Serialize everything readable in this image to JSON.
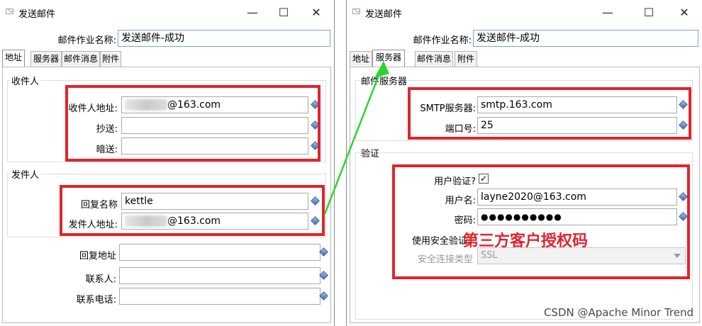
{
  "left": {
    "title": "发送邮件",
    "controls": {
      "minimize": "—",
      "maximize": "☐",
      "close": "✕"
    },
    "job_name_label": "邮件作业名称:",
    "job_name_value": "发送邮件-成功",
    "tabs": [
      "地址",
      "服务器",
      "邮件消息",
      "附件"
    ],
    "active_tab": "地址",
    "recipient_group": "收件人",
    "recipient_address_label": "收件人地址:",
    "recipient_address_suffix": "@163.com",
    "cc_label": "抄送:",
    "bcc_label": "暗送:",
    "sender_group": "发件人",
    "reply_name_label": "回复名称",
    "reply_name_value": "kettle",
    "sender_address_label": "发件人地址:",
    "sender_address_suffix": "@163.com",
    "reply_address_label": "回复地址",
    "contact_label": "联系人:",
    "contact_phone_label": "联系电话:"
  },
  "right": {
    "title": "发送邮件",
    "controls": {
      "minimize": "—",
      "maximize": "☐",
      "close": "✕"
    },
    "job_name_label": "邮件作业名称:",
    "job_name_value": "发送邮件-成功",
    "tabs": [
      "地址",
      "服务器",
      "邮件消息",
      "附件"
    ],
    "active_tab": "服务器",
    "mail_server_group": "邮件服务器",
    "smtp_label": "SMTP服务器:",
    "smtp_value": "smtp.163.com",
    "port_label": "端口号:",
    "port_value": "25",
    "auth_group": "验证",
    "use_auth_label": "用户验证?",
    "use_auth_checked": "✓",
    "username_label": "用户名:",
    "username_value": "layne2020@163.com",
    "password_label": "密码:",
    "password_value": "●●●●●●●●●●",
    "secure_auth_label": "使用安全验证",
    "secure_type_label": "安全连接类型",
    "secure_type_value": "SSL",
    "annotation": "第三方客户授权码"
  },
  "watermark": "CSDN @Apache Minor Trend",
  "colors": {
    "highlight_red": "#e0242c",
    "arrow_green": "#2bd62b",
    "focus_blue": "#7aa7d9"
  }
}
